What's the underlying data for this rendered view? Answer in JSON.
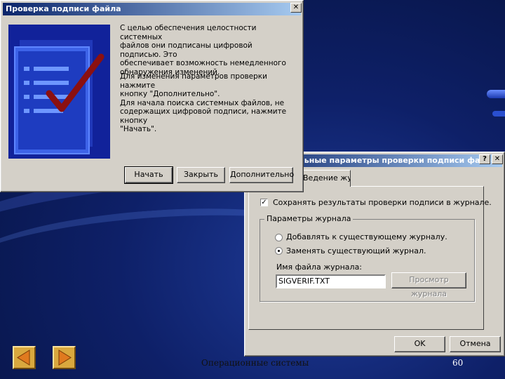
{
  "main_dialog": {
    "title": "Проверка подписи файла",
    "close_glyph": "✕",
    "paragraph1": [
      "С целью обеспечения целостности системных",
      "файлов они подписаны цифровой подписью. Это",
      "обеспечивает возможность немедленного",
      "обнаружения изменений."
    ],
    "paragraph2": [
      "Для изменения параметров проверки нажмите",
      "кнопку \"Дополнительно\".",
      "Для начала поиска системных файлов, не",
      "содержащих цифровой подписи, нажмите кнопку",
      "\"Начать\"."
    ],
    "buttons": {
      "start": "Начать",
      "close": "Закрыть",
      "advanced": "Дополнительно"
    }
  },
  "options_dialog": {
    "title": "Дополнительные параметры проверки подписи файла",
    "help_glyph": "?",
    "close_glyph": "✕",
    "tab_label": "Ведение журнала",
    "save_checkbox_label": "Сохранять результаты проверки подписи в журнале.",
    "save_checked": true,
    "group_label": "Параметры журнала",
    "radio_append": "Добавлять к существующему журналу.",
    "radio_replace": "Заменять существующий журнал.",
    "selected_radio": "replace",
    "filename_label": "Имя файла журнала:",
    "filename_value": "SIGVERIF.TXT",
    "view_log_button": "Просмотр журнала",
    "ok_button": "OK",
    "cancel_button": "Отмена"
  },
  "slide_footer": {
    "caption": "Операционные системы",
    "page_number": "60",
    "prev_icon": "triangle-left-icon",
    "next_icon": "triangle-right-icon"
  },
  "colors": {
    "title_bar_start": "#0a246a",
    "title_bar_end": "#a6caf0",
    "window_face": "#d4d0c8",
    "art_blue": "#11229a",
    "check_red": "#8b1010",
    "nav_button": "#d9a83e"
  }
}
